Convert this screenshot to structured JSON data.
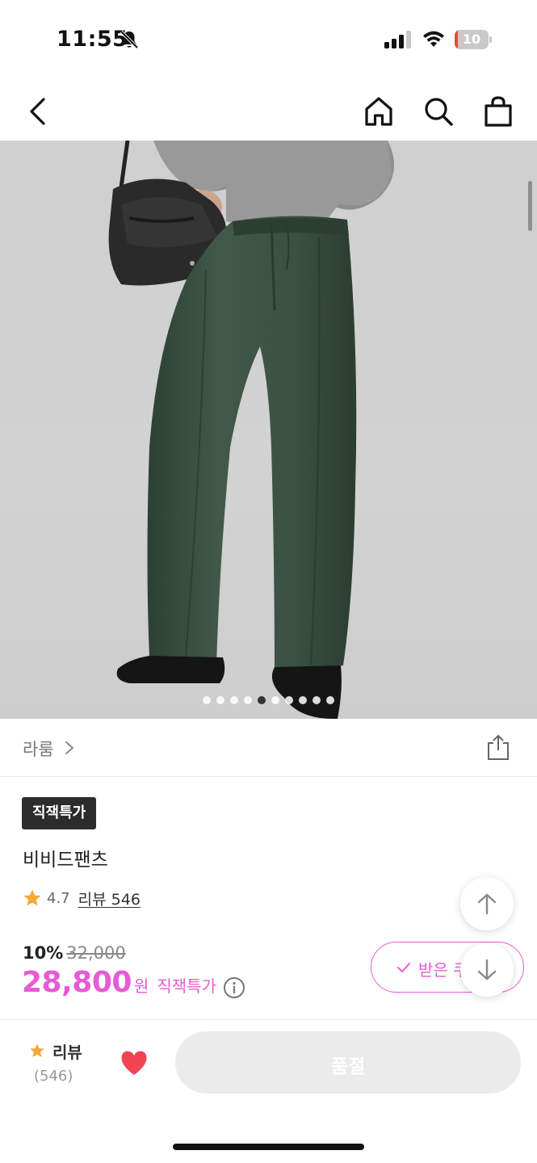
{
  "status_bar": {
    "time": "11:55",
    "battery_level_text": "10",
    "battery_level": 0.1,
    "icons": [
      "bell-muted-icon",
      "cellular-signal-icon",
      "wifi-icon",
      "battery-charging-icon"
    ]
  },
  "top_nav": {
    "icons": [
      "back-chevron-icon",
      "home-icon",
      "search-icon",
      "shopping-bag-icon"
    ]
  },
  "gallery": {
    "image_count": 10,
    "active_index": 4,
    "description_icon": "product-photo-green-wide-jeans"
  },
  "brand": {
    "name": "라룸",
    "share_icon": "share-icon"
  },
  "product": {
    "badge": "직잭특가",
    "title": "비비드팬츠",
    "rating": "4.7",
    "review_link": "리뷰 546",
    "discount_rate": "10%",
    "original_price": "32,000",
    "price": "28,800",
    "currency": "원",
    "price_tag": "직잭특가"
  },
  "coupon": {
    "label": "받은 쿠"
  },
  "bottom_bar": {
    "review_label": "리뷰",
    "review_count": "(546)",
    "cta_label": "품절",
    "liked": true
  },
  "colors": {
    "accent_pink": "#e85ad5",
    "badge_dark": "#2c2c2c",
    "star_orange": "#f4a836",
    "heart_red": "#f04452",
    "soldout_grey": "#ebebeb",
    "pants_green": "#3a4f40"
  }
}
